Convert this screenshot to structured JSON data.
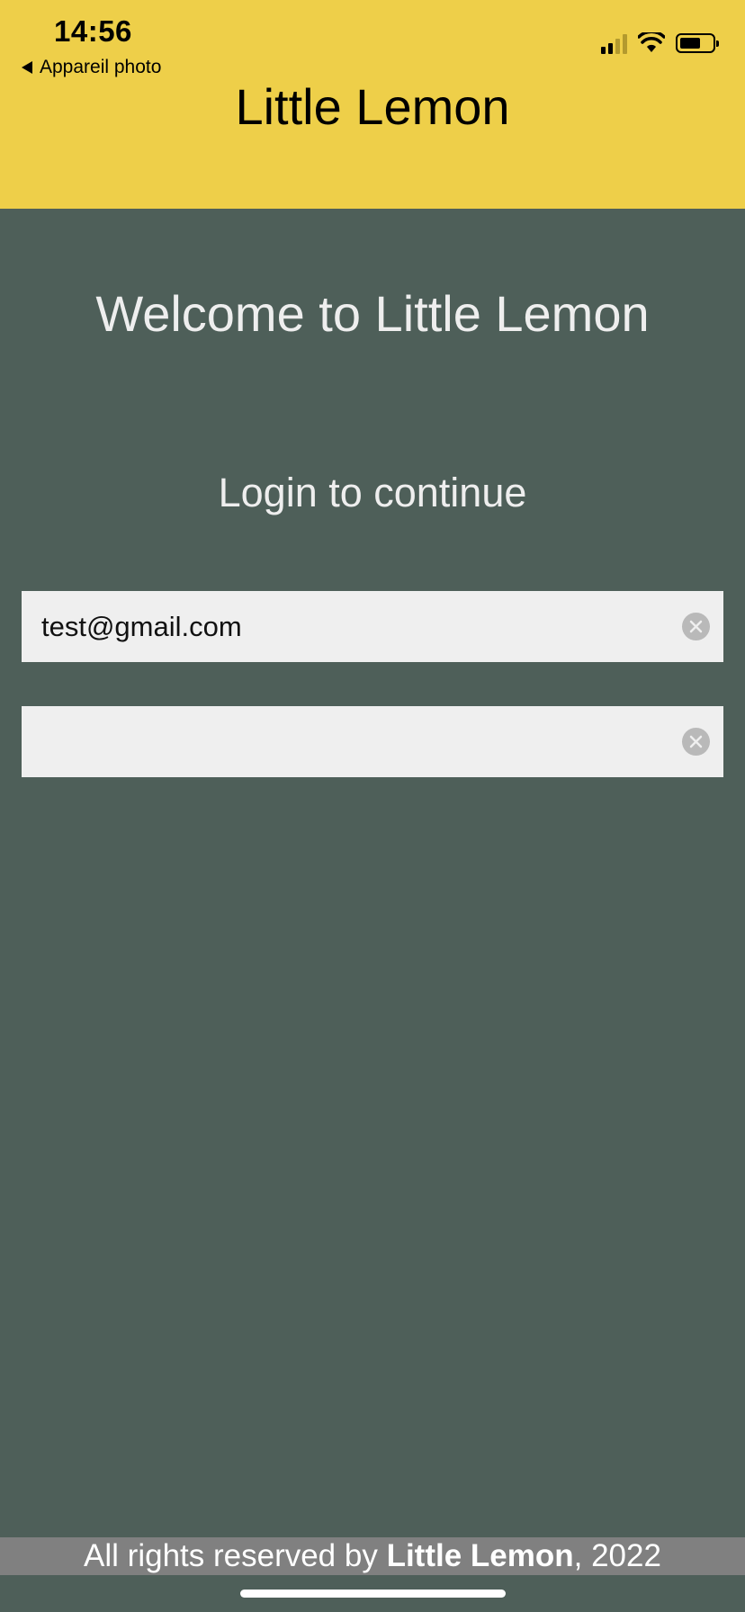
{
  "status_bar": {
    "time": "14:56",
    "back_label": "Appareil photo"
  },
  "header": {
    "title": "Little Lemon",
    "background_color": "#eecf49"
  },
  "main": {
    "welcome": "Welcome to Little Lemon",
    "subtitle": "Login to continue",
    "background_color": "#4e5f59",
    "email_field": {
      "value": "test@gmail.com",
      "placeholder": ""
    },
    "password_field": {
      "value": "",
      "placeholder": ""
    }
  },
  "footer": {
    "prefix": "All rights reserved by ",
    "brand": "Little Lemon",
    "suffix": ", 2022"
  },
  "icons": {
    "back": "back-triangle-icon",
    "signal": "cellular-signal-icon",
    "wifi": "wifi-icon",
    "battery": "battery-icon",
    "clear": "clear-circle-x-icon"
  }
}
